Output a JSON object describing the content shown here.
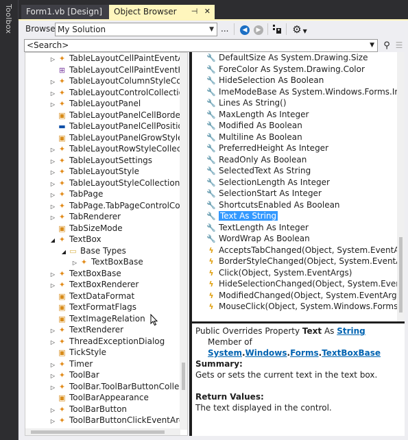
{
  "toolbox": {
    "label": "Toolbox"
  },
  "tabs": [
    {
      "label": "Form1.vb [Design]"
    },
    {
      "label": "Object Browser"
    }
  ],
  "toolbar": {
    "browse_label": "Browse:",
    "browse_value": "My Solution",
    "ellipsis": "..."
  },
  "search": {
    "placeholder": "<Search>"
  },
  "tree": [
    {
      "label": "TableLayoutCellPaintEventArgs",
      "icon": "class-icon",
      "expander": "collapsed",
      "indent": 0
    },
    {
      "label": "TableLayoutCellPaintEventHandle",
      "icon": "delegate-icon",
      "expander": "none",
      "indent": 0
    },
    {
      "label": "TableLayoutColumnStyleCollectic",
      "icon": "class-icon",
      "expander": "collapsed",
      "indent": 0
    },
    {
      "label": "TableLayoutControlCollection",
      "icon": "class-icon",
      "expander": "collapsed",
      "indent": 0
    },
    {
      "label": "TableLayoutPanel",
      "icon": "class-icon",
      "expander": "collapsed",
      "indent": 0
    },
    {
      "label": "TableLayoutPanelCellBorderStyle",
      "icon": "enum-icon",
      "expander": "none",
      "indent": 0
    },
    {
      "label": "TableLayoutPanelCellPosition",
      "icon": "struct-icon",
      "expander": "none",
      "indent": 0
    },
    {
      "label": "TableLayoutPanelGrowStyle",
      "icon": "enum-icon",
      "expander": "none",
      "indent": 0
    },
    {
      "label": "TableLayoutRowStyleCollection",
      "icon": "class-icon",
      "expander": "collapsed",
      "indent": 0
    },
    {
      "label": "TableLayoutSettings",
      "icon": "class-icon",
      "expander": "collapsed",
      "indent": 0
    },
    {
      "label": "TableLayoutStyle",
      "icon": "class-icon",
      "expander": "collapsed",
      "indent": 0
    },
    {
      "label": "TableLayoutStyleCollection",
      "icon": "class-icon",
      "expander": "collapsed",
      "indent": 0
    },
    {
      "label": "TabPage",
      "icon": "class-icon",
      "expander": "collapsed",
      "indent": 0
    },
    {
      "label": "TabPage.TabPageControlCollecti",
      "icon": "class-icon",
      "expander": "collapsed",
      "indent": 0
    },
    {
      "label": "TabRenderer",
      "icon": "class-icon",
      "expander": "collapsed",
      "indent": 0
    },
    {
      "label": "TabSizeMode",
      "icon": "enum-icon",
      "expander": "none",
      "indent": 0
    },
    {
      "label": "TextBox",
      "icon": "class-icon",
      "expander": "expanded",
      "indent": 0
    },
    {
      "label": "Base Types",
      "icon": "folder-icon",
      "expander": "expanded",
      "indent": 1
    },
    {
      "label": "TextBoxBase",
      "icon": "class-icon",
      "expander": "collapsed",
      "indent": 2
    },
    {
      "label": "TextBoxBase",
      "icon": "class-icon",
      "expander": "collapsed",
      "indent": 0
    },
    {
      "label": "TextBoxRenderer",
      "icon": "class-icon",
      "expander": "collapsed",
      "indent": 0
    },
    {
      "label": "TextDataFormat",
      "icon": "enum-icon",
      "expander": "none",
      "indent": 0
    },
    {
      "label": "TextFormatFlags",
      "icon": "enum-icon",
      "expander": "none",
      "indent": 0
    },
    {
      "label": "TextImageRelation",
      "icon": "enum-icon",
      "expander": "none",
      "indent": 0
    },
    {
      "label": "TextRenderer",
      "icon": "class-icon",
      "expander": "collapsed",
      "indent": 0
    },
    {
      "label": "ThreadExceptionDialog",
      "icon": "class-icon",
      "expander": "collapsed",
      "indent": 0
    },
    {
      "label": "TickStyle",
      "icon": "enum-icon",
      "expander": "none",
      "indent": 0
    },
    {
      "label": "Timer",
      "icon": "class-icon",
      "expander": "collapsed",
      "indent": 0
    },
    {
      "label": "ToolBar",
      "icon": "class-icon",
      "expander": "collapsed",
      "indent": 0
    },
    {
      "label": "ToolBar.ToolBarButtonCollection",
      "icon": "class-icon",
      "expander": "collapsed",
      "indent": 0
    },
    {
      "label": "ToolBarAppearance",
      "icon": "enum-icon",
      "expander": "none",
      "indent": 0
    },
    {
      "label": "ToolBarButton",
      "icon": "class-icon",
      "expander": "collapsed",
      "indent": 0
    },
    {
      "label": "ToolBarButtonClickEventArgs",
      "icon": "class-icon",
      "expander": "collapsed",
      "indent": 0
    }
  ],
  "members": [
    {
      "label": "DefaultSize As System.Drawing.Size",
      "kind": "property"
    },
    {
      "label": "ForeColor As System.Drawing.Color",
      "kind": "property"
    },
    {
      "label": "HideSelection As Boolean",
      "kind": "property"
    },
    {
      "label": "ImeModeBase As System.Windows.Forms.ImeMode",
      "kind": "property"
    },
    {
      "label": "Lines As String()",
      "kind": "property"
    },
    {
      "label": "MaxLength As Integer",
      "kind": "property"
    },
    {
      "label": "Modified As Boolean",
      "kind": "property"
    },
    {
      "label": "Multiline As Boolean",
      "kind": "property"
    },
    {
      "label": "PreferredHeight As Integer",
      "kind": "property"
    },
    {
      "label": "ReadOnly As Boolean",
      "kind": "property"
    },
    {
      "label": "SelectedText As String",
      "kind": "property"
    },
    {
      "label": "SelectionLength As Integer",
      "kind": "property"
    },
    {
      "label": "SelectionStart As Integer",
      "kind": "property"
    },
    {
      "label": "ShortcutsEnabled As Boolean",
      "kind": "property"
    },
    {
      "label": "Text As String",
      "kind": "property",
      "selected": true
    },
    {
      "label": "TextLength As Integer",
      "kind": "property"
    },
    {
      "label": "WordWrap As Boolean",
      "kind": "property"
    },
    {
      "label": "AcceptsTabChanged(Object, System.EventArgs)",
      "kind": "event"
    },
    {
      "label": "BorderStyleChanged(Object, System.EventArgs)",
      "kind": "event"
    },
    {
      "label": "Click(Object, System.EventArgs)",
      "kind": "event"
    },
    {
      "label": "HideSelectionChanged(Object, System.EventArgs)",
      "kind": "event"
    },
    {
      "label": "ModifiedChanged(Object, System.EventArgs)",
      "kind": "event"
    },
    {
      "label": "MouseClick(Object, System.Windows.Forms.MouseE",
      "kind": "event"
    }
  ],
  "description": {
    "prefix": "Public Overrides Property ",
    "name": "Text",
    "as_word": " As ",
    "type_link": "String",
    "member_of_prefix": "Member of ",
    "member_of_parts": [
      "System",
      "Windows",
      "Forms",
      "TextBoxBase"
    ],
    "member_of_sep": ".",
    "summary_heading": "Summary:",
    "summary_text": "Gets or sets the current text in the text box.",
    "return_heading": "Return Values:",
    "return_text": "The text displayed in the control."
  },
  "colors": {
    "tab_active": "#fff6bd",
    "selection": "#3399ff",
    "link": "#0063b1",
    "class_icon": "#e28b1a",
    "event_icon": "#e0a010"
  }
}
